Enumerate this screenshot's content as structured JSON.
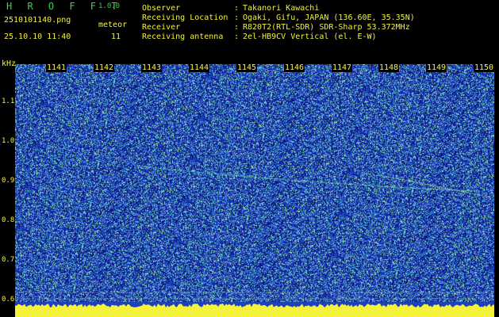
{
  "header": {
    "logo": "H R O F F T",
    "version": "1.0.0",
    "filename": "2510101140.png",
    "meteor_label": "meteor",
    "timestamp": "25.10.10 11:40",
    "meteor_count": "11"
  },
  "station_info": [
    {
      "label": "Observer",
      "colon": ":",
      "value": "Takanori Kawachi"
    },
    {
      "label": "Receiving Location",
      "colon": ":",
      "value": "Ogaki, Gifu, JAPAN (136.60E, 35.35N)"
    },
    {
      "label": "Receiver",
      "colon": ":",
      "value": "R820T2(RTL-SDR) SDR-Sharp 53.372MHz"
    },
    {
      "label": "Receiving antenna",
      "colon": ":",
      "value": "2el-HB9CV Vertical (el. E-W)"
    }
  ],
  "y_axis": {
    "unit": "kHz",
    "ticks": [
      "1.1",
      "1.0",
      "0.9",
      "0.8",
      "0.7",
      "0.6"
    ]
  },
  "x_axis": {
    "ticks": [
      "1141",
      "1142",
      "1143",
      "1144",
      "1145",
      "1146",
      "1147",
      "1148",
      "1149",
      "1150"
    ]
  },
  "colors": {
    "label": "#f4f23a",
    "logo": "#3bd24a",
    "spectrogram_base": "#1f3fbf",
    "noise_floor": "#f4f23a"
  }
}
